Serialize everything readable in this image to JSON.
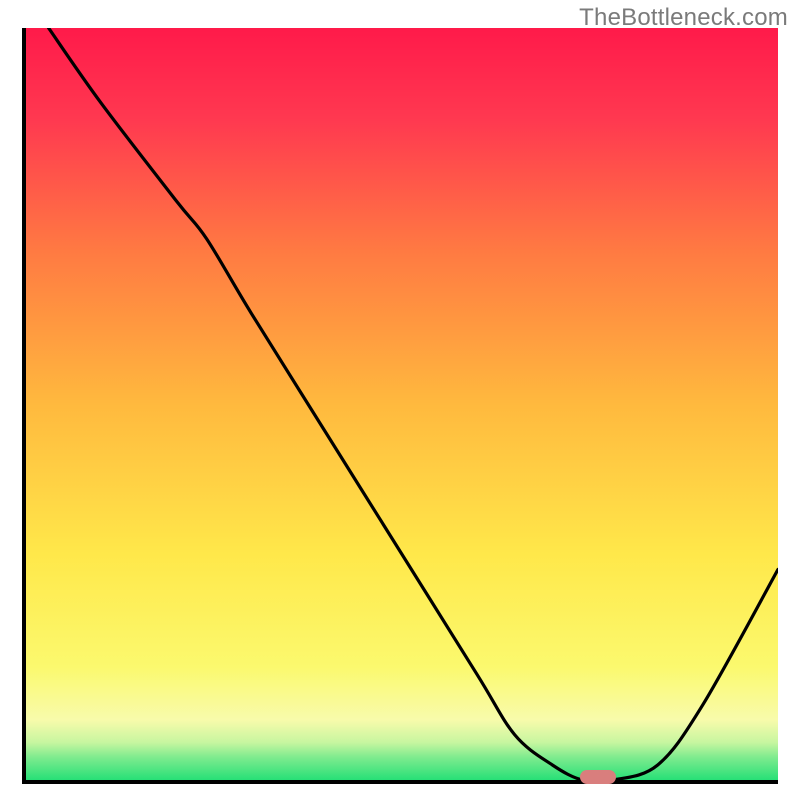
{
  "watermark": "TheBottleneck.com",
  "colors": {
    "gradient_top": "#ff1a4a",
    "gradient_mid_orange": "#ff8a3a",
    "gradient_mid_yellow": "#ffe84a",
    "gradient_light": "#fdfca0",
    "gradient_green": "#27e077",
    "axis": "#000000",
    "curve": "#000000",
    "marker": "#d97e7d"
  },
  "chart_data": {
    "type": "line",
    "title": "",
    "xlabel": "",
    "ylabel": "",
    "xlim": [
      0,
      100
    ],
    "ylim": [
      0,
      100
    ],
    "grid": false,
    "series": [
      {
        "name": "bottleneck-curve",
        "x": [
          3,
          10,
          20,
          24,
          30,
          40,
          50,
          60,
          65,
          70,
          74,
          78,
          84,
          90,
          100
        ],
        "y": [
          100,
          90,
          77,
          72,
          62,
          46,
          30,
          14,
          6,
          2,
          0,
          0,
          2,
          10,
          28
        ]
      }
    ],
    "annotations": [
      {
        "name": "optimal-marker",
        "x": 76,
        "y": 0,
        "kind": "pill"
      }
    ]
  }
}
